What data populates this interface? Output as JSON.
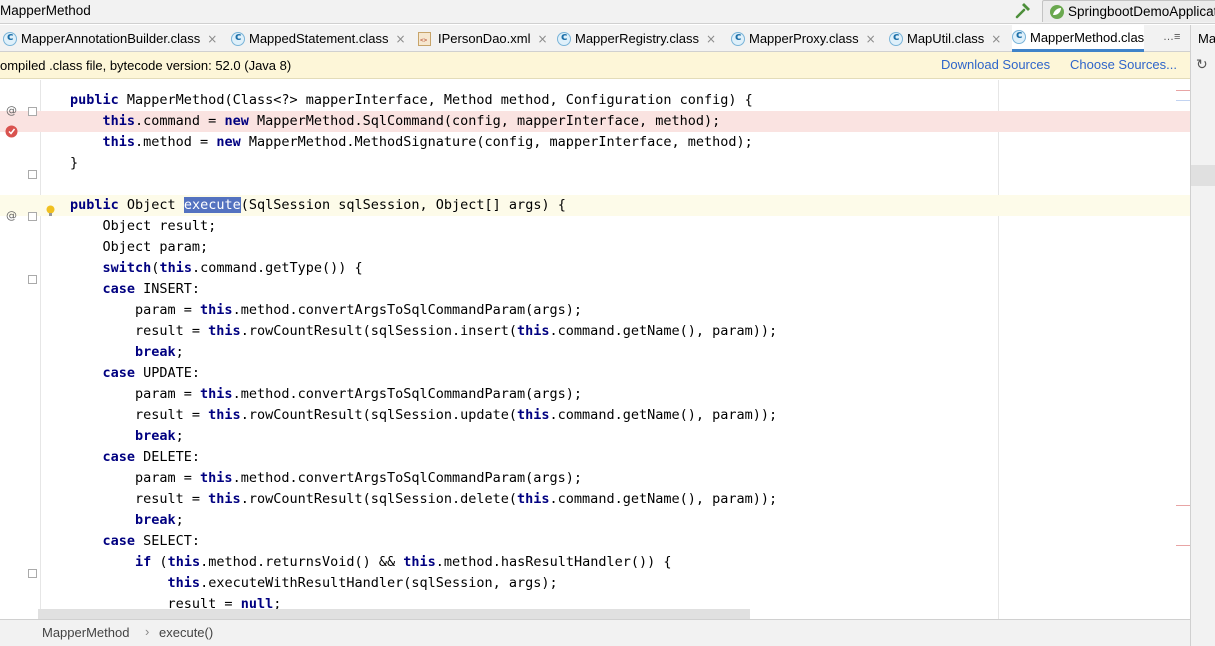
{
  "window": {
    "title": "MapperMethod",
    "run_config": "SpringbootDemoApplicat"
  },
  "tabs": [
    {
      "label": "MapperAnnotationBuilder.class",
      "icon": "class-icon",
      "active": false
    },
    {
      "label": "MappedStatement.class",
      "icon": "class-icon",
      "active": false
    },
    {
      "label": "IPersonDao.xml",
      "icon": "xml-file-icon",
      "active": false
    },
    {
      "label": "MapperRegistry.class",
      "icon": "class-icon",
      "active": false
    },
    {
      "label": "MapperProxy.class",
      "icon": "class-icon",
      "active": false
    },
    {
      "label": "MapUtil.class",
      "icon": "class-icon",
      "active": false
    },
    {
      "label": "MapperMethod.clas",
      "icon": "class-icon",
      "active": true
    }
  ],
  "tab_overflow": "…≡",
  "right_panel": {
    "label": "Ma"
  },
  "banner": {
    "message": "ompiled .class file, bytecode version: 52.0 (Java 8)",
    "download_sources": "Download Sources",
    "choose_sources": "Choose Sources..."
  },
  "editor": {
    "lines": [
      "public MapperMethod(Class<?> mapperInterface, Method method, Configuration config) {",
      "    this.command = new MapperMethod.SqlCommand(config, mapperInterface, method);",
      "    this.method = new MapperMethod.MethodSignature(config, mapperInterface, method);",
      "}",
      "",
      "public Object execute(SqlSession sqlSession, Object[] args) {",
      "    Object result;",
      "    Object param;",
      "    switch(this.command.getType()) {",
      "    case INSERT:",
      "        param = this.method.convertArgsToSqlCommandParam(args);",
      "        result = this.rowCountResult(sqlSession.insert(this.command.getName(), param));",
      "        break;",
      "    case UPDATE:",
      "        param = this.method.convertArgsToSqlCommandParam(args);",
      "        result = this.rowCountResult(sqlSession.update(this.command.getName(), param));",
      "        break;",
      "    case DELETE:",
      "        param = this.method.convertArgsToSqlCommandParam(args);",
      "        result = this.rowCountResult(sqlSession.delete(this.command.getName(), param));",
      "        break;",
      "    case SELECT:",
      "        if (this.method.returnsVoid() && this.method.hasResultHandler()) {",
      "            this.executeWithResultHandler(sqlSession, args);",
      "            result = null;"
    ],
    "breakpoint_line": 2,
    "caret_line": 6,
    "selected_word": "execute",
    "keywords": [
      "public",
      "this",
      "new",
      "switch",
      "case",
      "break",
      "if",
      "null"
    ]
  },
  "breadcrumbs": {
    "class": "MapperMethod",
    "method": "execute()"
  },
  "colors": {
    "keyword": "#000080",
    "selection": "#5472c0",
    "breakpoint_bg": "#fae3e1",
    "caret_bg": "#fdfbe9",
    "link": "#2f65ca",
    "banner_bg": "#fdf6d8"
  }
}
